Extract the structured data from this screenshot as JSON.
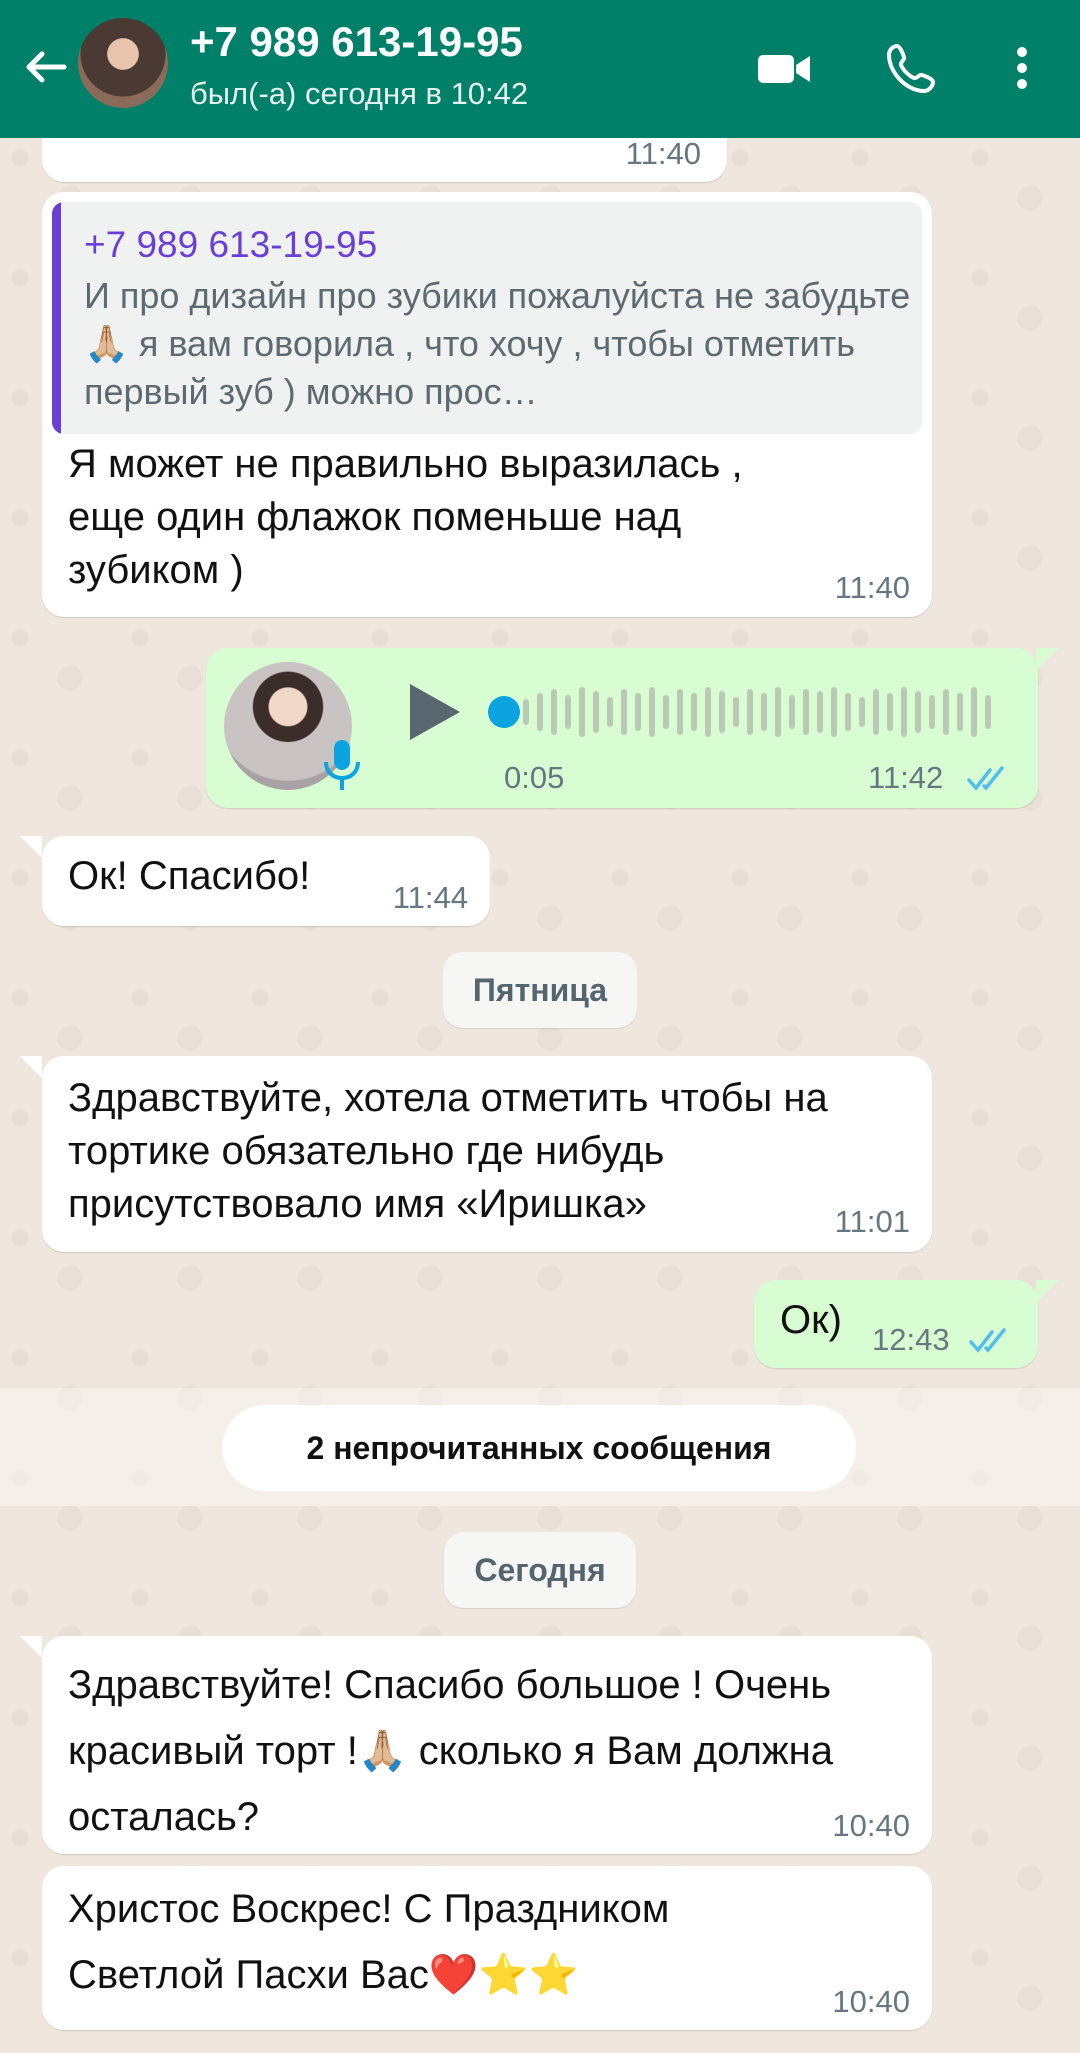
{
  "header": {
    "contact_name": "+7 989 613-19-95",
    "status": "был(-а) сегодня в 10:42",
    "icons": [
      "back-arrow-icon",
      "avatar",
      "video-call-icon",
      "phone-call-icon",
      "more-vertical-icon"
    ],
    "color": "#008069"
  },
  "messages": [
    {
      "time": "11:40"
    },
    {
      "quote_author": "+7 989 613-19-95",
      "quote_text": "И про дизайн про зубики пожалуйста не забудьте !🙏🏼 я вам говорила , что хочу , чтобы отметить первый зуб ) можно прос…",
      "text": "Я может не правильно выразилась , еще один флажок поменьше над зубиком )",
      "time": "11:40"
    },
    {
      "voice_duration": "0:05",
      "time": "11:42",
      "status": "read"
    },
    {
      "text": "Ок! Спасибо!",
      "time": "11:44"
    },
    {
      "text": "Здравствуйте, хотела отметить чтобы на тортике обязательно где нибудь присутствовало имя «Иришка»",
      "time": "11:01"
    },
    {
      "text": "Ок)",
      "time": "12:43",
      "status": "read"
    },
    {
      "text": "Здравствуйте! Спасибо большое ! Очень красивый торт !🙏🏼 сколько я Вам должна осталась?",
      "time": "10:40"
    },
    {
      "text": "Христос Воскрес! С Праздником Светлой Пасхи Вас❤️⭐️⭐️",
      "time": "10:40"
    }
  ],
  "date_friday": "Пятница",
  "date_today": "Сегодня",
  "unread_label": "2 непрочитанных сообщения",
  "colors": {
    "incoming": "#ffffff",
    "outgoing": "#d9fdd3",
    "tick_read": "#53bdeb",
    "quote_accent": "#6a3fd6",
    "voice_accent": "#0ba4e0"
  }
}
